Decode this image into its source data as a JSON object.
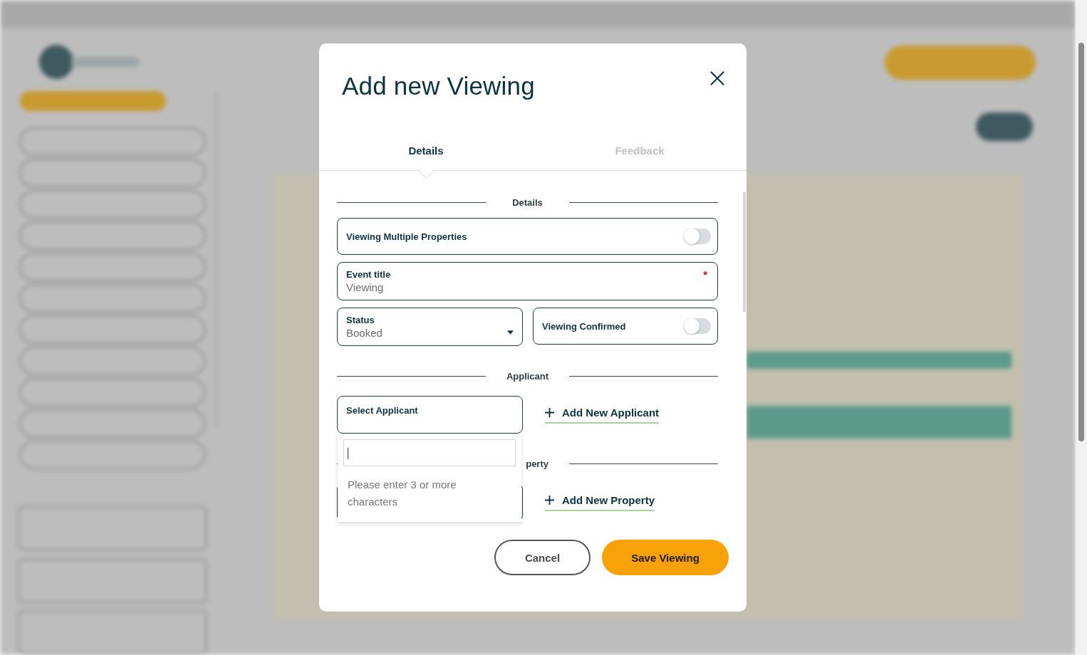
{
  "modal": {
    "title": "Add new Viewing",
    "tabs": [
      {
        "label": "Details",
        "selected": true
      },
      {
        "label": "Feedback",
        "selected": false
      }
    ],
    "sections": [
      {
        "heading": "Details",
        "rows": [
          [
            {
              "kind": "toggle",
              "label": "Viewing Multiple Properties",
              "on": false
            }
          ],
          [
            {
              "kind": "text",
              "label": "Event title",
              "value": "Viewing",
              "required_mark": "*"
            }
          ],
          [
            {
              "kind": "select",
              "label": "Status",
              "value": "Booked"
            },
            {
              "kind": "toggle",
              "label": "Viewing Confirmed",
              "on": false
            }
          ]
        ]
      },
      {
        "heading": "Applicant",
        "rows": [
          [
            {
              "kind": "lookup",
              "label": "Select Applicant",
              "dropdown": {
                "message": "Please enter 3 or more characters"
              }
            },
            {
              "kind": "link",
              "label": "Add New Applicant"
            }
          ]
        ]
      },
      {
        "heading": "perty",
        "rows": [
          [
            {
              "kind": "lookup"
            },
            {
              "kind": "link",
              "label": "Add New Property"
            }
          ]
        ]
      }
    ],
    "buttons": [
      {
        "label": "Cancel",
        "kind": "secondary"
      },
      {
        "label": "Save Viewing",
        "kind": "primary"
      }
    ]
  }
}
